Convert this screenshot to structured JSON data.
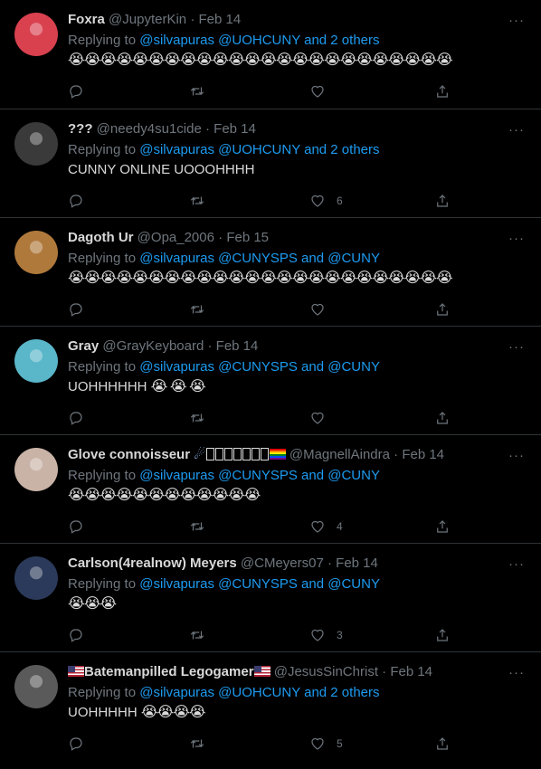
{
  "tweets": [
    {
      "name": "Foxra",
      "handle": "@JupyterKin",
      "date": "Feb 14",
      "replying_prefix": "Replying to ",
      "mentions": "@silvapuras @UOHCUNY and 2 others",
      "text": "",
      "emojis": "😭😭😭😭😭😭😭😭😭😭😭😭😭😭😭😭😭😭😭😭😭😭😭😭",
      "reply_count": "",
      "retweet_count": "",
      "like_count": "",
      "avatar_color": "#d9414f"
    },
    {
      "name": "???",
      "handle": "@needy4su1cide",
      "date": "Feb 14",
      "replying_prefix": "Replying to ",
      "mentions": "@silvapuras @UOHCUNY and 2 others",
      "text": "CUNNY ONLINE UOOOHHHH",
      "emojis": "",
      "reply_count": "",
      "retweet_count": "",
      "like_count": "6",
      "avatar_color": "#3a3a3a"
    },
    {
      "name": "Dagoth Ur",
      "handle": "@Opa_2006",
      "date": "Feb 15",
      "replying_prefix": "Replying to ",
      "mentions": "@silvapuras @CUNYSPS and @CUNY",
      "text": "",
      "emojis": "😭😭😭😭😭😭😭😭😭😭😭😭😭😭😭😭😭😭😭😭😭😭😭😭",
      "reply_count": "",
      "retweet_count": "",
      "like_count": "",
      "avatar_color": "#b0793c"
    },
    {
      "name": "Gray",
      "handle": "@GrayKeyboard",
      "date": "Feb 14",
      "replying_prefix": "Replying to ",
      "mentions": "@silvapuras @CUNYSPS and @CUNY",
      "text": "UOHHHHHH ",
      "emojis": "😭 😭 😭",
      "reply_count": "",
      "retweet_count": "",
      "like_count": "",
      "avatar_color": "#5ab6c9"
    },
    {
      "name": "Glove connoisseur ",
      "handle": "@MagnellAindra",
      "date": "Feb 14",
      "replying_prefix": "Replying to ",
      "mentions": "@silvapuras @CUNYSPS and @CUNY",
      "text": "",
      "emojis": "😭😭😭😭😭😭😭😭😭😭😭😭",
      "reply_count": "",
      "retweet_count": "",
      "like_count": "4",
      "avatar_color": "#c9b3a6"
    },
    {
      "name": "Carlson(4realnow) Meyers",
      "handle": "@CMeyers07",
      "date": "Feb 14",
      "replying_prefix": "Replying to ",
      "mentions": "@silvapuras @CUNYSPS and @CUNY",
      "text": "",
      "emojis": "😭😭😭",
      "reply_count": "",
      "retweet_count": "",
      "like_count": "3",
      "avatar_color": "#2b3a5a"
    },
    {
      "name": "Batemanpilled Legogamer",
      "handle": "@JesusSinChrist",
      "date": "Feb 14",
      "replying_prefix": "Replying to ",
      "mentions": "@silvapuras @UOHCUNY and 2 others",
      "text": "UOHHHHH ",
      "emojis": "😭😭😭😭",
      "reply_count": "",
      "retweet_count": "",
      "like_count": "5",
      "avatar_color": "#5a5a5a"
    }
  ],
  "more_label": "···",
  "dot": "·",
  "icons": {
    "reply": "reply-icon",
    "retweet": "retweet-icon",
    "like": "like-icon",
    "share": "share-icon",
    "more": "more-icon"
  }
}
